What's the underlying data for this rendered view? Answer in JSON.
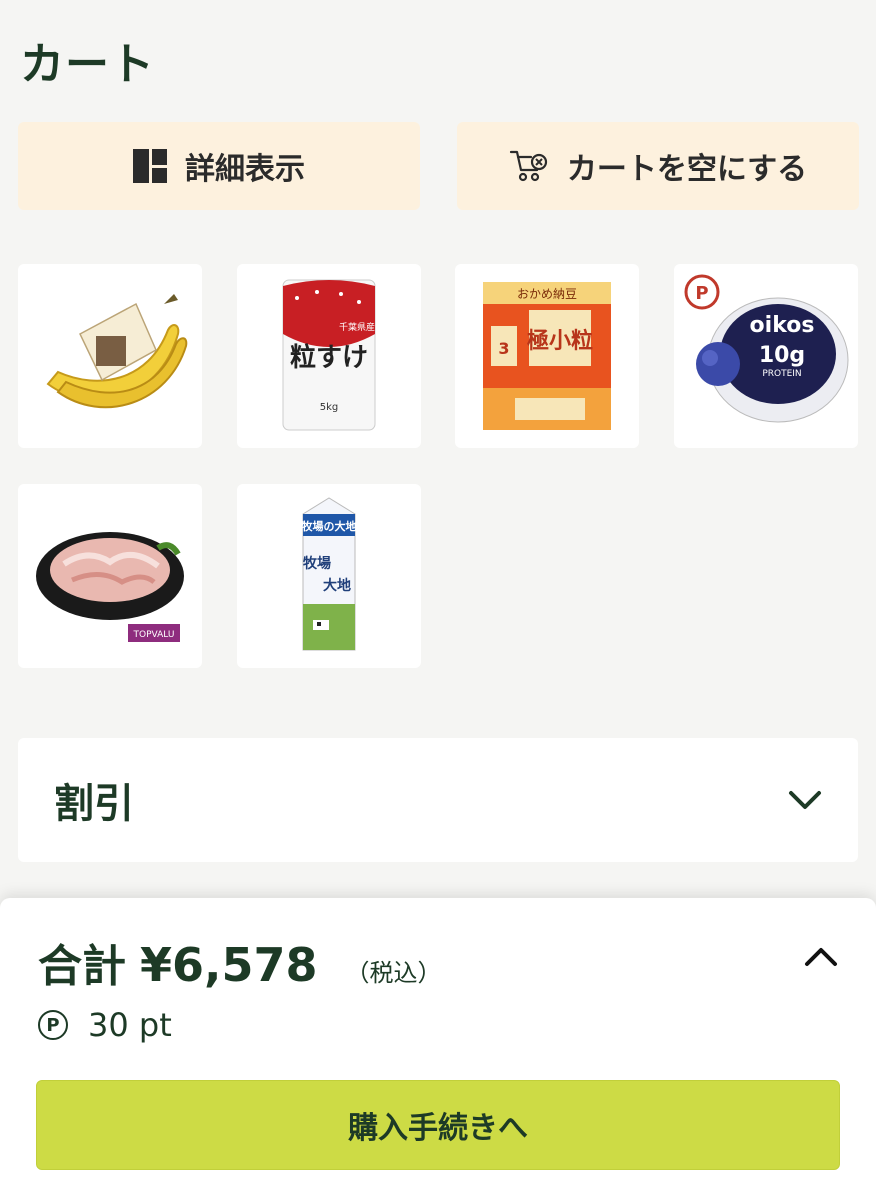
{
  "header": {
    "title": "カート"
  },
  "actions": {
    "detail_label": "詳細表示",
    "empty_label": "カートを空にする"
  },
  "products": [
    {
      "name": "banana"
    },
    {
      "name": "rice",
      "label": "粒すけ",
      "weight": "5kg",
      "origin": "千葉県産"
    },
    {
      "name": "natto",
      "brand": "おかめ納豆",
      "label": "極小粒",
      "badge": "ミニ 3"
    },
    {
      "name": "yogurt",
      "brand": "oikos",
      "label": "10g",
      "sub": "PROTEIN",
      "point_mark": "P"
    },
    {
      "name": "pork",
      "brand": "TOPVALU"
    },
    {
      "name": "milk",
      "label": "牧場の大地"
    }
  ],
  "discount": {
    "label": "割引"
  },
  "summary": {
    "total_label": "合計",
    "total_amount": "¥6,578",
    "tax_note": "（税込）",
    "points_icon": "P",
    "points": "30 pt"
  },
  "checkout": {
    "label": "購入手続きへ"
  },
  "colors": {
    "primary_text": "#1d3a26",
    "action_bg": "#fdf1de",
    "checkout_bg": "#cddb45",
    "page_bg": "#f5f5f3"
  }
}
